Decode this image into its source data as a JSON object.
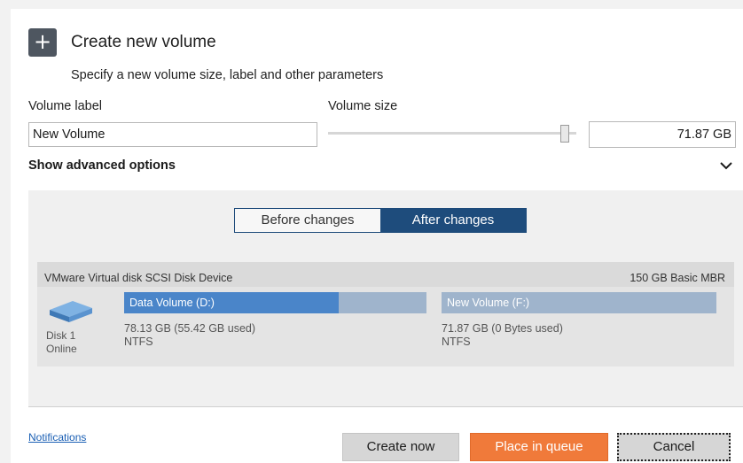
{
  "dialog": {
    "title": "Create new volume",
    "subtitle": "Specify a new volume size, label and other parameters",
    "plus_glyph": "+"
  },
  "form": {
    "volume_label_caption": "Volume label",
    "volume_label_value": "New Volume",
    "volume_size_caption": "Volume size",
    "volume_size_value": "71.87 GB",
    "slider_level_percent": 97
  },
  "advanced": {
    "label": "Show advanced options",
    "icon": "chevron-down-icon"
  },
  "preview": {
    "tabs": [
      {
        "label": "Before changes",
        "selected": false
      },
      {
        "label": "After changes",
        "selected": true
      }
    ],
    "disk": {
      "name": "VMware Virtual disk SCSI Disk Device",
      "info": "150 GB Basic MBR",
      "id_line1": "Disk 1",
      "id_line2": "Online",
      "icon": "hard-disk-icon"
    },
    "volumes": [
      {
        "label": "Data Volume (D:)",
        "size": "78.13 GB (55.42 GB used)",
        "fs": "NTFS",
        "used_fraction": 0.71,
        "color": "#4a85c9",
        "free_color": "#9fb4cc"
      },
      {
        "label": "New Volume (F:)",
        "size": "71.87 GB (0 Bytes used)",
        "fs": "NTFS",
        "used_fraction": 0.0,
        "color": "#4a85c9",
        "free_color": "#9fb4cc"
      }
    ]
  },
  "footer": {
    "notifications_link": "Notifications",
    "create_now": "Create now",
    "place_in_queue": "Place in queue",
    "cancel": "Cancel"
  },
  "colors": {
    "accent": "#f07a3a",
    "selected_tab": "#1e4c7c",
    "volume_blue": "#4a85c9",
    "volume_free": "#9fb4cc"
  }
}
